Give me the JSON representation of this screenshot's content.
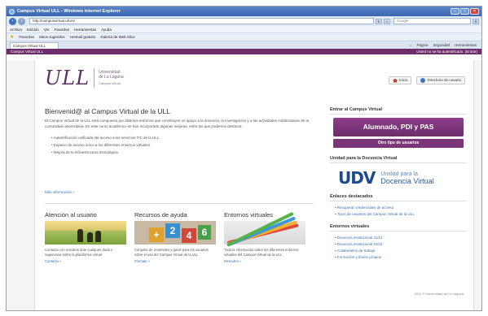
{
  "window": {
    "title": "Campus Virtual ULL - Windows Internet Explorer"
  },
  "addressbar": {
    "url": "http://campusvirtual.ull.es/",
    "search_placeholder": "Google"
  },
  "menu": [
    "Archivo",
    "Edición",
    "Ver",
    "Favoritos",
    "Herramientas",
    "Ayuda"
  ],
  "favorites": {
    "label": "Favoritos",
    "items": [
      "Sitios sugeridos",
      "Hotmail gratuito",
      "Galería de Web Slice"
    ]
  },
  "tab": {
    "label": "Campus Virtual ULL"
  },
  "commandbar": [
    "Página",
    "Seguridad",
    "Herramientas"
  ],
  "site_strip": {
    "left": "Campus Virtual ULL",
    "right": "Usted no se ha autentificado. (Entrar)"
  },
  "logo": {
    "mark": "ULL",
    "line1": "Universidad",
    "line2": "de La Laguna",
    "line3": "Campus virtual"
  },
  "top_buttons": {
    "home": "Inicio",
    "directory": "Directorio de usuario"
  },
  "welcome": {
    "title": "Bienvenid@ al Campus Virtual de la ULL",
    "body": "El Campus Virtual de la ULL está compuesto por distintos entornos que constituyen un apoyo a la docencia, la investigación y a las actividades colaborativas de la comunidad universitaria. En este curso académico se han incorporado algunas mejoras, entre las que podemos destacar:",
    "bullets": [
      "Autentificación unificada del acceso a los servicios TIC de la ULL.",
      "Espacio de acceso único a los diferentes entornos virtuales.",
      "Mejora de la infraestructura tecnológica."
    ],
    "more": "Más información »"
  },
  "cards": [
    {
      "title": "Atención al usuario",
      "text": "Contacta con nosotros ante cualquier duda o sugerencia sobre la plataforma virtual",
      "link": "Contacta »"
    },
    {
      "title": "Recursos de ayuda",
      "text": "Conjunto de materiales y guías para los usuarios sobre el uso del Campus Virtual de la ULL",
      "link": "Fórmate »"
    },
    {
      "title": "Entornos virtuales",
      "text": "Toda la información sobre los diferentes entornos virtuales del Campus Virtual de la ULL",
      "link": "Descubre »"
    }
  ],
  "right": {
    "access_heading": "Entrar al Campus Virtual",
    "primary_button": "Alumnado, PDI y PAS",
    "secondary_button": "Otro tipo de usuarios",
    "udv_heading": "Unidad para la Docencia Virtual",
    "udv_mark": "UDV",
    "udv_line1": "Unidad para la",
    "udv_line2": "Docencia Virtual",
    "links_heading": "Enlaces destacados",
    "links": [
      "Recuperar credenciales de acceso",
      "Tipos de usuarios del Campus Virtual de la ULL"
    ],
    "envs_heading": "Entornos virtuales",
    "envs": [
      "Docencia institucional 11/12",
      "Docencia institucional 10/11",
      "Colaborativo de trabajo",
      "Formación y títulos propios"
    ]
  },
  "footer": "2011 © Universidad de La Laguna"
}
